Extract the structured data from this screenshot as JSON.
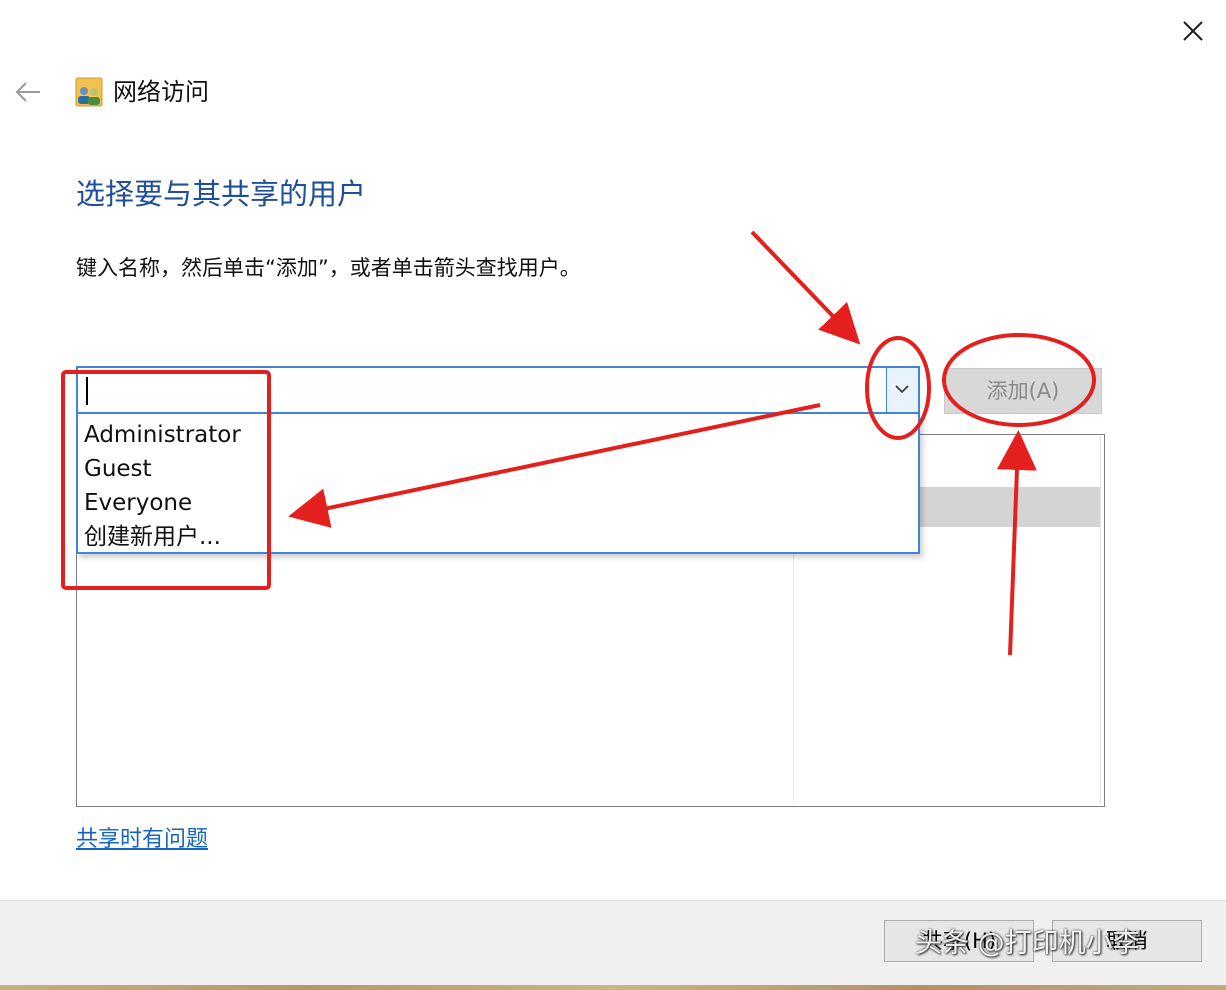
{
  "window": {
    "title": "网络访问",
    "close_icon": "close-icon",
    "back_icon": "back-arrow-icon",
    "title_icon": "network-users-icon"
  },
  "main": {
    "heading": "选择要与其共享的用户",
    "instruction": "键入名称，然后单击“添加”，或者单击箭头查找用户。",
    "name_input": {
      "value": "",
      "dropdown_icon": "chevron-down-icon"
    },
    "add_button": "添加(A)",
    "dropdown_options": [
      "Administrator",
      "Guest",
      "Everyone",
      "创建新用户..."
    ],
    "help_link": "共享时有问题"
  },
  "footer": {
    "share_button": "共享(H)",
    "cancel_button": "取消"
  },
  "watermark": "头条 @打印机小李",
  "colors": {
    "heading_blue": "#1f4e9a",
    "focus_blue": "#3f86d8",
    "link_blue": "#1565c0",
    "annotation_red": "#e4201e"
  }
}
